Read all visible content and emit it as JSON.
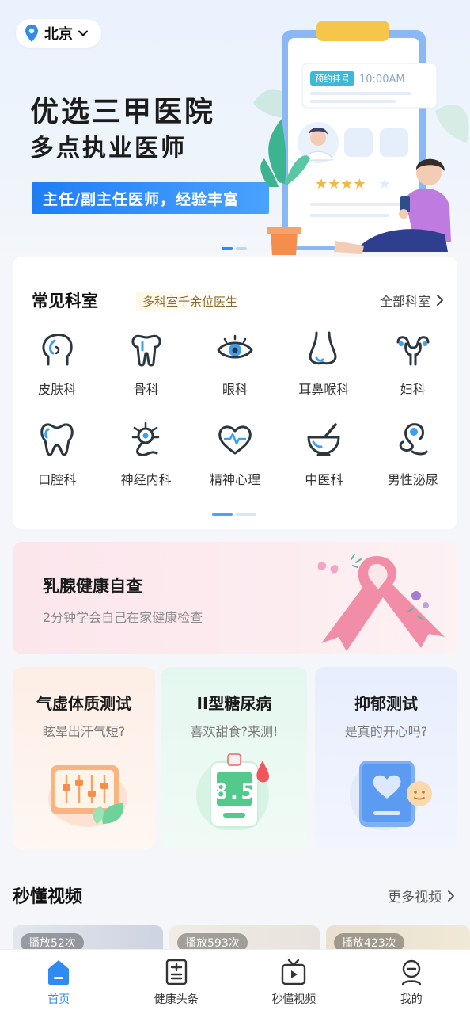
{
  "location": {
    "city": "北京"
  },
  "banner": {
    "title": "优选三甲医院",
    "subtitle": "多点执业医师",
    "tag": "主任/副主任医师，经验丰富",
    "illustration": {
      "badge": "预约挂号",
      "time": "10:00AM"
    },
    "page_count": 2,
    "active_page": 1
  },
  "departments": {
    "title": "常见科室",
    "subtitle": "多科室千余位医生",
    "all_link": "全部科室",
    "items": [
      {
        "label": "皮肤科",
        "icon": "skin-icon"
      },
      {
        "label": "骨科",
        "icon": "bone-icon"
      },
      {
        "label": "眼科",
        "icon": "eye-icon"
      },
      {
        "label": "耳鼻喉科",
        "icon": "nose-icon"
      },
      {
        "label": "妇科",
        "icon": "uterus-icon"
      },
      {
        "label": "口腔科",
        "icon": "tooth-icon"
      },
      {
        "label": "神经内科",
        "icon": "neuron-icon"
      },
      {
        "label": "精神心理",
        "icon": "heart-pulse-icon"
      },
      {
        "label": "中医科",
        "icon": "mortar-icon"
      },
      {
        "label": "男性泌尿",
        "icon": "male-urology-icon"
      }
    ],
    "page_count": 2,
    "active_page": 1
  },
  "breast": {
    "title": "乳腺健康自查",
    "subtitle": "2分钟学会自己在家健康检查"
  },
  "tests": [
    {
      "title": "气虚体质测试",
      "subtitle": "眩晕出汗气短?",
      "icon": "monitor-leaf-icon"
    },
    {
      "title": "II型糖尿病",
      "subtitle": "喜欢甜食?来测!",
      "icon": "glucose-meter-icon",
      "reading": "8.5"
    },
    {
      "title": "抑郁测试",
      "subtitle": "是真的开心吗?",
      "icon": "phone-heart-icon"
    }
  ],
  "videos": {
    "title": "秒懂视频",
    "more": "更多视频",
    "items": [
      {
        "plays": "播放52次"
      },
      {
        "plays": "播放593次"
      },
      {
        "plays": "播放423次"
      }
    ]
  },
  "tabbar": {
    "items": [
      {
        "label": "首页",
        "icon": "home-icon",
        "active": true
      },
      {
        "label": "健康头条",
        "icon": "news-icon",
        "active": false
      },
      {
        "label": "秒懂视频",
        "icon": "video-icon",
        "active": false
      },
      {
        "label": "我的",
        "icon": "profile-icon",
        "active": false
      }
    ]
  },
  "colors": {
    "accent": "#2f8bf2",
    "icon_stroke": "#2a3640",
    "icon_accent": "#3aa0f0",
    "breast_bg": "#fbe6ec",
    "ribbon": "#f07c9a"
  }
}
